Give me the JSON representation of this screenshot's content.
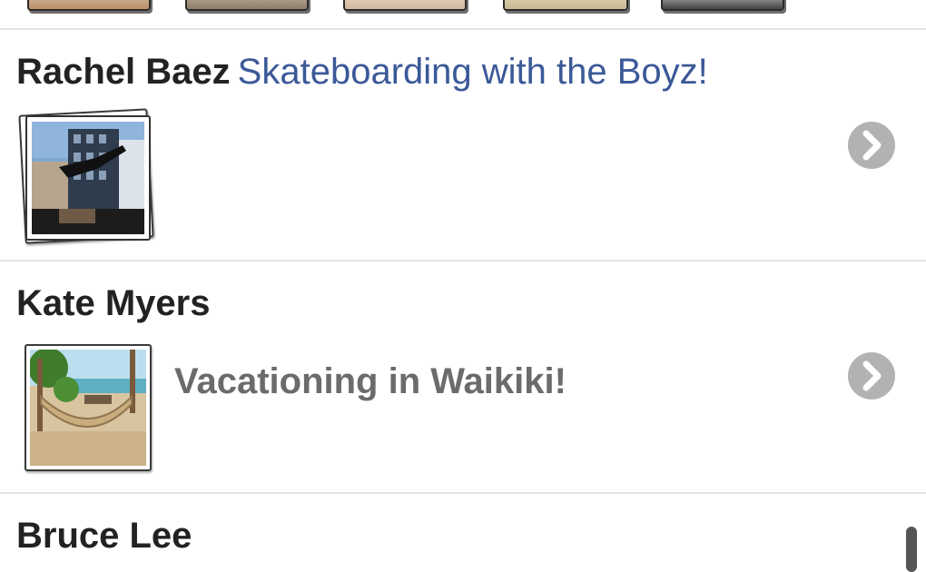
{
  "feed": {
    "items": [
      {
        "name": "Rachel Baez",
        "caption": "Skateboarding with the Boyz!",
        "thumbnail": "skateboard-photo",
        "action_icon": "chevron-right-icon"
      },
      {
        "name": "Kate Myers",
        "status": "Vacationing in Waikiki!",
        "thumbnail": "beach-hammock-photo",
        "action_icon": "chevron-right-icon"
      },
      {
        "name": "Bruce Lee"
      }
    ]
  },
  "colors": {
    "link": "#3b5998",
    "name": "#222222",
    "status": "#6b6b6b",
    "divider": "#e3e3e3",
    "chevron": "#b2b2b2"
  }
}
